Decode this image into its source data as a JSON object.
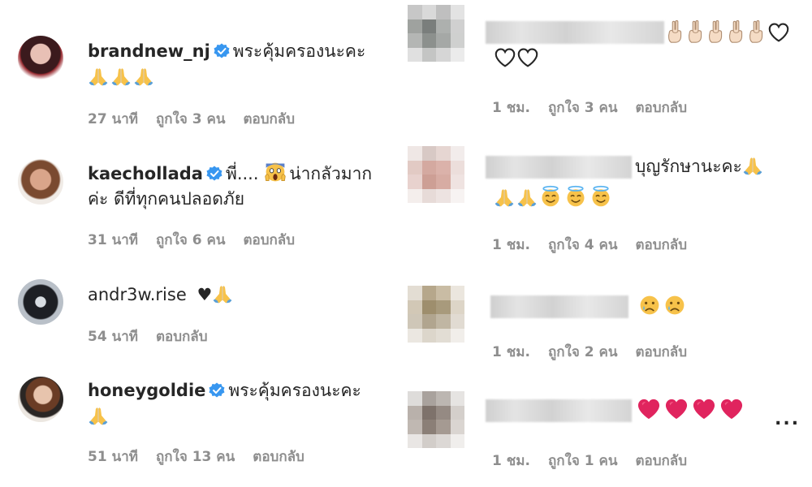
{
  "left_comments": [
    {
      "username": "brandnew_nj",
      "verified": true,
      "text_line1": "พระคุ้มครองนะคะ",
      "time": "27 นาที",
      "likes": "ถูกใจ 3 คน",
      "reply": "ตอบกลับ"
    },
    {
      "username": "kaechollada",
      "verified": true,
      "text_line1": "พี่....",
      "text_line1b": "น่ากลัวมาก",
      "text_line2": "ค่ะ ดีที่ทุกคนปลอดภัย",
      "time": "31 นาที",
      "likes": "ถูกใจ 6 คน",
      "reply": "ตอบกลับ"
    },
    {
      "username": "andr3w.rise",
      "verified": false,
      "text_line1": "♥",
      "time": "54 นาที",
      "reply": "ตอบกลับ"
    },
    {
      "username": "honeygoldie",
      "verified": true,
      "text_line1": "พระคุ้มครองนะคะ",
      "time": "51 นาที",
      "likes": "ถูกใจ 13 คน",
      "reply": "ตอบกลับ"
    }
  ],
  "right_comments": [
    {
      "time": "1 ชม.",
      "likes": "ถูกใจ 3 คน",
      "reply": "ตอบกลับ"
    },
    {
      "text": "บุญรักษานะคะ",
      "time": "1 ชม.",
      "likes": "ถูกใจ 4 คน",
      "reply": "ตอบกลับ"
    },
    {
      "time": "1 ชม.",
      "likes": "ถูกใจ 2 คน",
      "reply": "ตอบกลับ"
    },
    {
      "time": "1 ชม.",
      "likes": "ถูกใจ 1 คน",
      "reply": "ตอบกลับ",
      "more": "..."
    }
  ],
  "colors": {
    "verified_blue": "#3897f0",
    "meta_gray": "#8e8e8e",
    "heart_red": "#e0245e",
    "pray_yellow": "#f7c24a"
  },
  "icons": [
    "verified-badge-icon",
    "pray-emoji-icon",
    "scream-emoji-icon",
    "heart-icon",
    "halo-face-emoji-icon",
    "crying-face-emoji-icon",
    "peace-hand-emoji-icon",
    "more-options-icon"
  ]
}
